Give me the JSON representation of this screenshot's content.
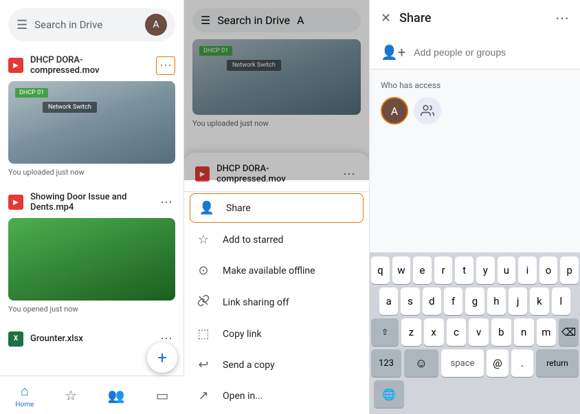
{
  "left_panel": {
    "search_placeholder": "Search in Drive",
    "avatar_initial": "A",
    "files": [
      {
        "name": "DHCP DORA-compressed.mov",
        "type": "video",
        "meta": "You uploaded just now",
        "thumbnail_badge": "DHCP 01",
        "thumbnail_label": "Network Switch",
        "highlighted": true
      },
      {
        "name": "Showing Door Issue and Dents.mp4",
        "type": "video",
        "meta": "You opened just now",
        "highlighted": false
      },
      {
        "name": "Grounter.xlsx",
        "type": "excel",
        "highlighted": false
      }
    ],
    "nav_items": [
      {
        "label": "Home",
        "icon": "⌂",
        "active": true
      },
      {
        "label": "",
        "icon": "☆",
        "active": false
      },
      {
        "label": "",
        "icon": "👥",
        "active": false
      },
      {
        "label": "",
        "icon": "▭",
        "active": false
      }
    ],
    "fab_icon": "+"
  },
  "mid_panel": {
    "search_placeholder": "Search in Drive",
    "file_name": "DHCP DORA-compressed.mov",
    "file_meta": "You uploaded just now",
    "thumbnail_badge": "DHCP 01",
    "thumbnail_label": "Network Switch",
    "menu_items": [
      {
        "id": "share",
        "icon": "👤+",
        "label": "Share",
        "highlighted": true
      },
      {
        "id": "starred",
        "icon": "☆",
        "label": "Add to starred",
        "highlighted": false
      },
      {
        "id": "offline",
        "icon": "⊙",
        "label": "Make available offline",
        "highlighted": false
      },
      {
        "id": "link-sharing",
        "icon": "🔗",
        "label": "Link sharing off",
        "highlighted": false
      },
      {
        "id": "copy-link",
        "icon": "⬚",
        "label": "Copy link",
        "highlighted": false
      },
      {
        "id": "send-copy",
        "icon": "↩",
        "label": "Send a copy",
        "highlighted": false
      },
      {
        "id": "open-in",
        "icon": "↗",
        "label": "Open in...",
        "highlighted": false
      }
    ]
  },
  "right_panel": {
    "title": "Share",
    "close_icon": "✕",
    "more_icon": "⋯",
    "add_people_icon": "👤+",
    "add_people_placeholder": "Add people or groups",
    "who_has_access_label": "Who has access",
    "keyboard_rows": [
      [
        "q",
        "w",
        "e",
        "r",
        "t",
        "y",
        "u",
        "i",
        "o",
        "p"
      ],
      [
        "a",
        "s",
        "d",
        "f",
        "g",
        "h",
        "j",
        "k",
        "l"
      ],
      [
        "z",
        "x",
        "c",
        "v",
        "b",
        "n",
        "m"
      ],
      [
        "123",
        "emoji",
        "space",
        "@",
        ".",
        "return"
      ]
    ]
  }
}
